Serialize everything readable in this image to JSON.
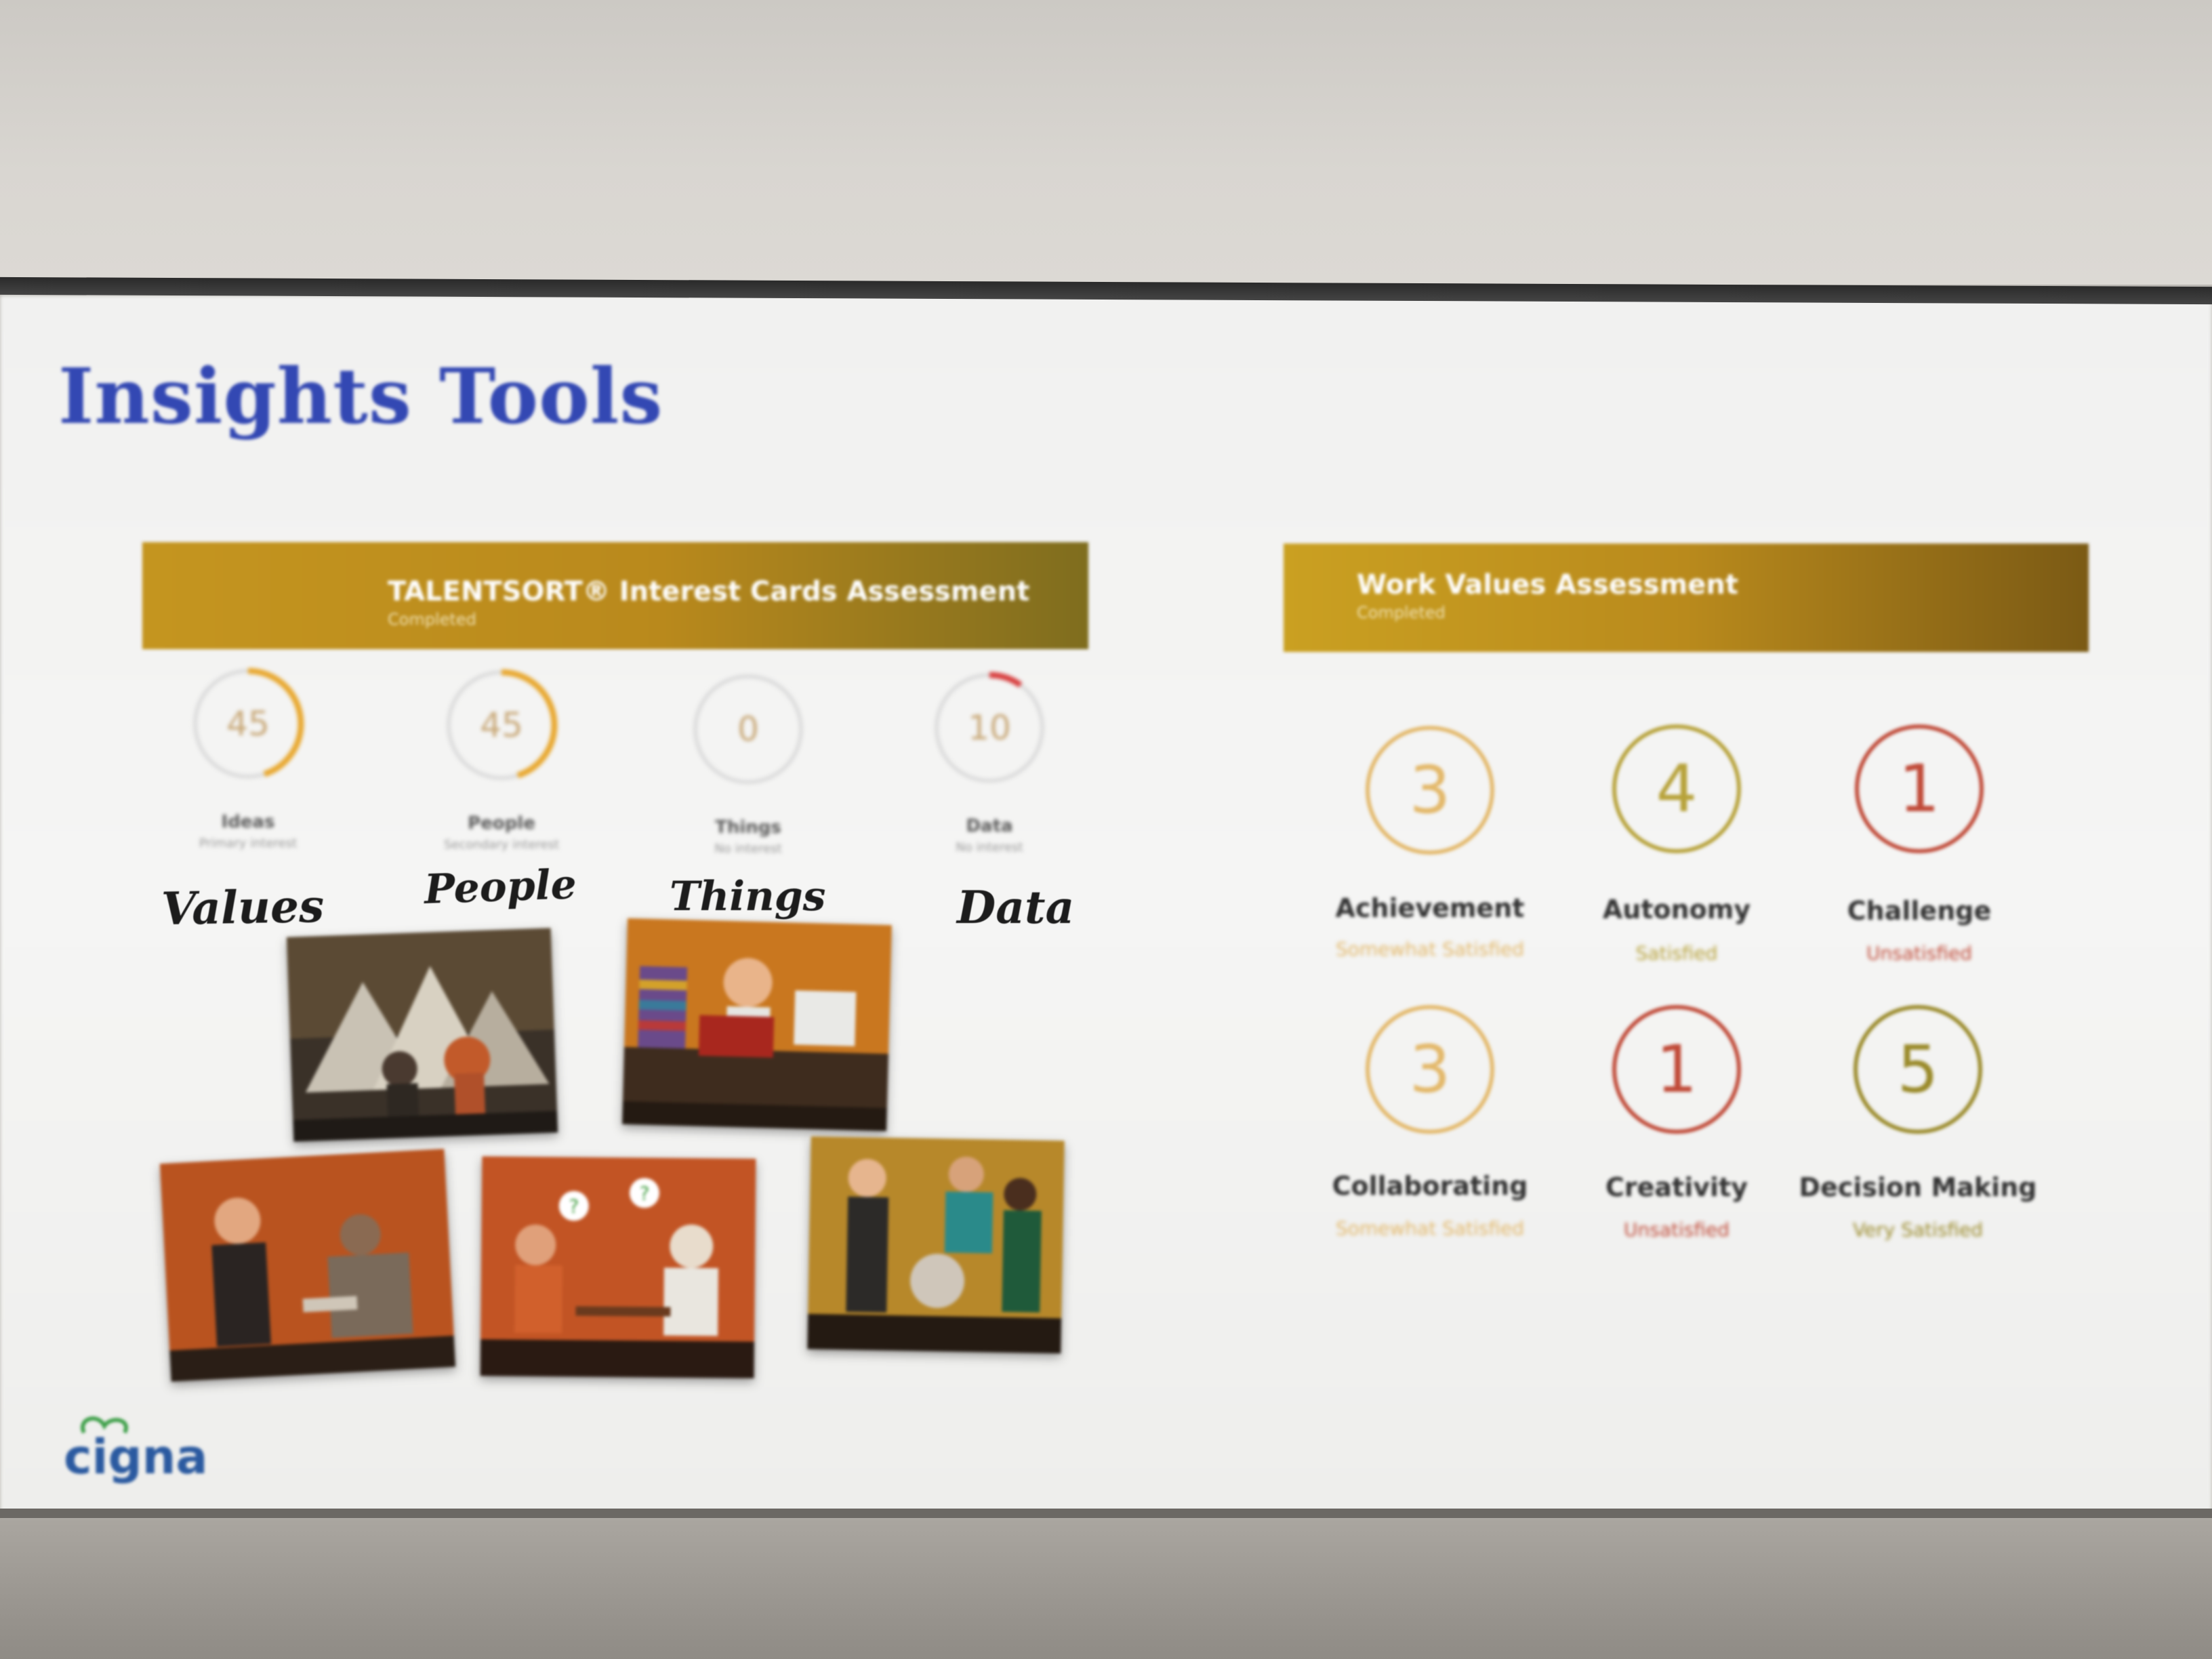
{
  "slide": {
    "title": "Insights Tools",
    "logo_text": "cigna"
  },
  "talentsort": {
    "banner_title": "TALENTSORT® Interest Cards Assessment",
    "banner_status": "Completed",
    "gauges": [
      {
        "value": "45",
        "label": "Ideas",
        "sub": "Primary interest",
        "fraction": 0.45,
        "color": "#e8a830"
      },
      {
        "value": "45",
        "label": "People",
        "sub": "Secondary interest",
        "fraction": 0.45,
        "color": "#e8a830"
      },
      {
        "value": "0",
        "label": "Things",
        "sub": "No interest",
        "fraction": 0.0,
        "color": "#e8a830"
      },
      {
        "value": "10",
        "label": "Data",
        "sub": "No interest",
        "fraction": 0.1,
        "color": "#d84040"
      }
    ],
    "handwritten_labels": [
      "Values",
      "People",
      "Things",
      "Data"
    ]
  },
  "work_values": {
    "banner_title": "Work Values Assessment",
    "banner_status": "Completed",
    "items": [
      {
        "value": "3",
        "label": "Achievement",
        "status": "Somewhat Satisfied",
        "color": "#e3b86a"
      },
      {
        "value": "4",
        "label": "Autonomy",
        "status": "Satisfied",
        "color": "#b7a23a"
      },
      {
        "value": "1",
        "label": "Challenge",
        "status": "Unsatisfied",
        "color": "#c04a38"
      },
      {
        "value": "3",
        "label": "Collaborating",
        "status": "Somewhat Satisfied",
        "color": "#e3b86a"
      },
      {
        "value": "1",
        "label": "Creativity",
        "status": "Unsatisfied",
        "color": "#c04a38"
      },
      {
        "value": "5",
        "label": "Decision Making",
        "status": "Very Satisfied",
        "color": "#9a8a2a"
      }
    ]
  }
}
